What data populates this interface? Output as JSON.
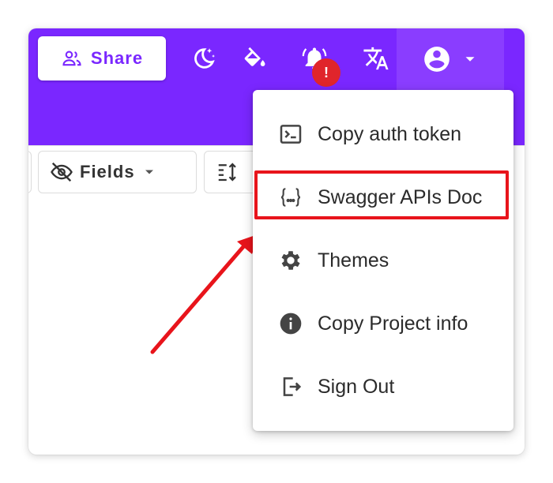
{
  "header": {
    "share_label": "Share",
    "notification_badge": "!",
    "brand_color": "#7a27ff",
    "icons": [
      "moon-stars-icon",
      "paint-bucket-icon",
      "bell-alert-icon",
      "translate-icon",
      "account-circle-icon",
      "caret-down-icon"
    ]
  },
  "toolbar": {
    "fields_label": "Fields"
  },
  "account_menu": {
    "items": [
      {
        "label": "Copy auth token",
        "icon": "terminal-icon"
      },
      {
        "label": "Swagger APIs Doc",
        "icon": "curly-braces-icon",
        "highlighted": true
      },
      {
        "label": "Themes",
        "icon": "gear-icon"
      },
      {
        "label": "Copy Project info",
        "icon": "info-icon"
      },
      {
        "label": "Sign Out",
        "icon": "sign-out-icon"
      }
    ]
  },
  "annotation": {
    "highlight_color": "#e8141b"
  }
}
